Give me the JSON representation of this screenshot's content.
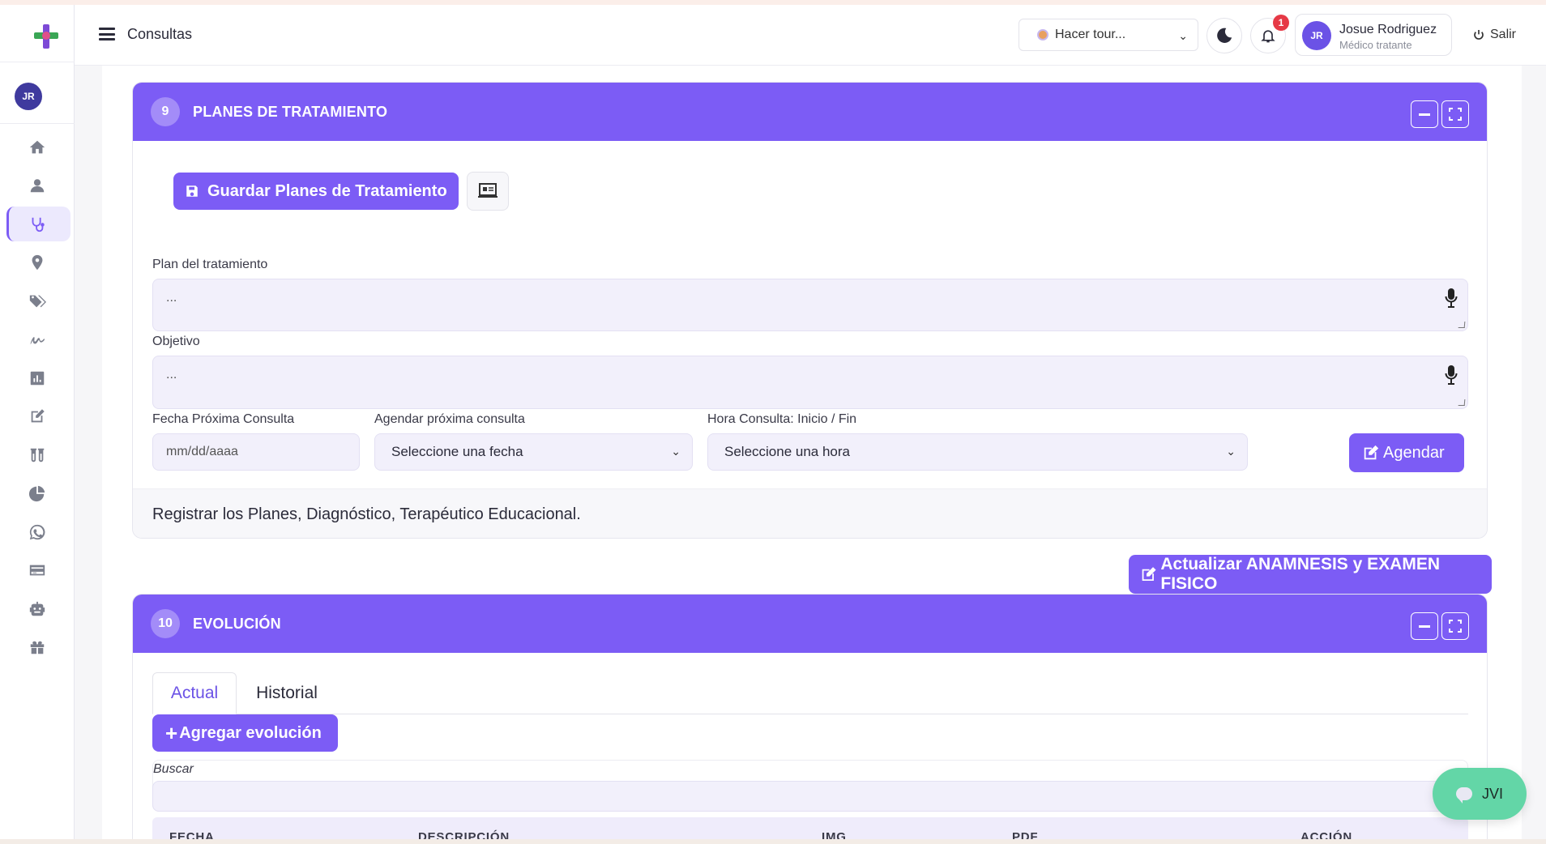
{
  "header": {
    "page_title": "Consultas",
    "tour_select": "Hacer tour...",
    "notifications_count": "1",
    "user": {
      "initials": "JR",
      "name": "Josue Rodriguez",
      "role": "Médico tratante"
    },
    "logout_label": "Salir"
  },
  "sidebar": {
    "avatar_initials": "JR",
    "items": [
      {
        "icon": "home-icon"
      },
      {
        "icon": "user-icon"
      },
      {
        "icon": "stethoscope-icon",
        "active": true
      },
      {
        "icon": "map-pin-icon"
      },
      {
        "icon": "tags-icon"
      },
      {
        "icon": "signature-icon"
      },
      {
        "icon": "bar-chart-icon"
      },
      {
        "icon": "edit-icon"
      },
      {
        "icon": "test-tubes-icon"
      },
      {
        "icon": "pie-chart-icon"
      },
      {
        "icon": "whatsapp-icon"
      },
      {
        "icon": "credit-card-icon"
      },
      {
        "icon": "robot-icon"
      },
      {
        "icon": "gift-icon"
      }
    ]
  },
  "planes": {
    "step": "9",
    "title": "PLANES DE TRATAMIENTO",
    "save_button": "Guardar Planes de Tratamiento",
    "plan_label": "Plan del tratamiento",
    "plan_value": "...",
    "objetivo_label": "Objetivo",
    "objetivo_value": "...",
    "fecha_label": "Fecha Próxima Consulta",
    "fecha_placeholder": "mm/dd/aaaa",
    "agendar_label": "Agendar próxima consulta",
    "agendar_select": "Seleccione una fecha",
    "hora_label": "Hora Consulta: Inicio / Fin",
    "hora_select": "Seleccione una hora",
    "agendar_button": "Agendar",
    "footer_text": "Registrar los Planes, Diagnóstico, Terapéutico Educacional."
  },
  "actualizar_button": "Actualizar ANAMNESIS y EXAMEN FISICO",
  "evolucion": {
    "step": "10",
    "title": "EVOLUCIÓN",
    "tabs": [
      "Actual",
      "Historial"
    ],
    "add_button": "Agregar evolución",
    "search_label": "Buscar",
    "columns": [
      "FECHA",
      "DESCRIPCIÓN",
      "IMG",
      "PDF",
      "ACCIÓN"
    ]
  },
  "chat_widget": {
    "label": "JVI"
  },
  "colors": {
    "accent": "#7c5cf5",
    "chat": "#63d6a7",
    "badge": "#e63946"
  }
}
